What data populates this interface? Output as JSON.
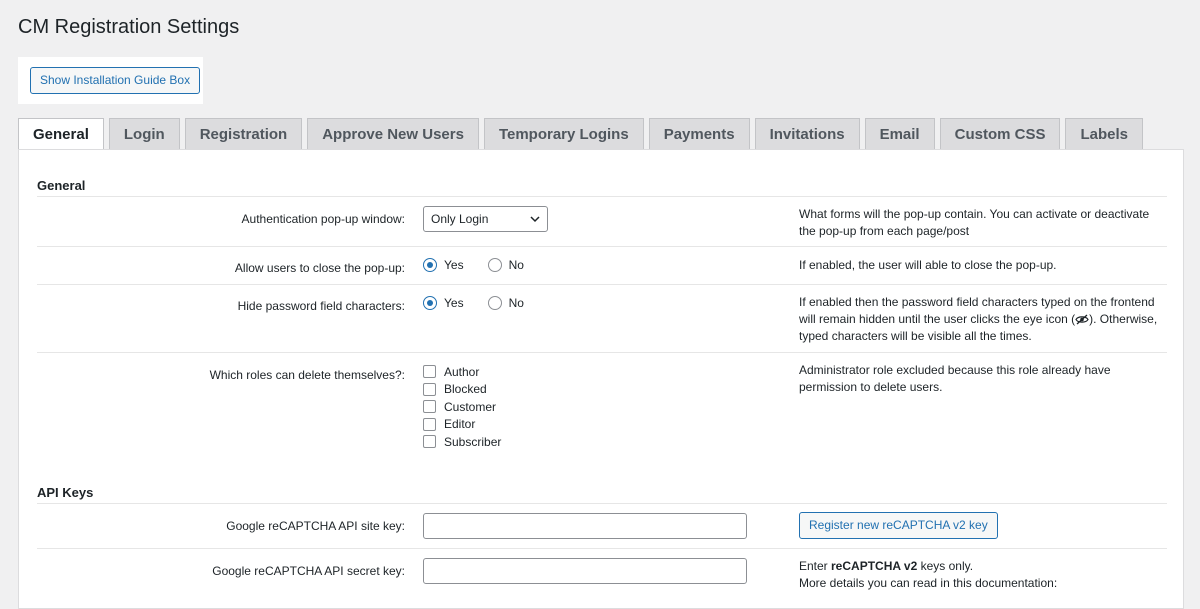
{
  "page": {
    "title": "CM Registration Settings"
  },
  "guide": {
    "button_label": "Show Installation Guide Box"
  },
  "tabs": [
    {
      "label": "General",
      "active": true
    },
    {
      "label": "Login"
    },
    {
      "label": "Registration"
    },
    {
      "label": "Approve New Users"
    },
    {
      "label": "Temporary Logins"
    },
    {
      "label": "Payments"
    },
    {
      "label": "Invitations"
    },
    {
      "label": "Email"
    },
    {
      "label": "Custom CSS"
    },
    {
      "label": "Labels"
    }
  ],
  "general": {
    "title": "General",
    "auth_popup": {
      "label": "Authentication pop-up window:",
      "value": "Only Login",
      "desc": "What forms will the pop-up contain. You can activate or deactivate the pop-up from each page/post"
    },
    "close_popup": {
      "label": "Allow users to close the pop-up:",
      "yes": "Yes",
      "no": "No",
      "selected": "Yes",
      "desc": "If enabled, the user will able to close the pop-up."
    },
    "hide_password": {
      "label": "Hide password field characters:",
      "yes": "Yes",
      "no": "No",
      "selected": "Yes",
      "desc_before": "If enabled then the password field characters typed on the frontend will remain hidden until the user clicks the eye icon (",
      "desc_after": "). Otherwise, typed characters will be visible all the times."
    },
    "delete_roles": {
      "label": "Which roles can delete themselves?:",
      "roles": [
        "Author",
        "Blocked",
        "Customer",
        "Editor",
        "Subscriber"
      ],
      "desc": "Administrator role excluded because this role already have permission to delete users."
    }
  },
  "api_keys": {
    "title": "API Keys",
    "site_key": {
      "label": "Google reCAPTCHA API site key:",
      "value": "",
      "button_label": "Register new reCAPTCHA v2 key"
    },
    "secret_key": {
      "label": "Google reCAPTCHA API secret key:",
      "value": "",
      "desc_prefix": "Enter ",
      "desc_bold": "reCAPTCHA v2",
      "desc_suffix": " keys only.",
      "desc_line2": "More details you can read in this documentation:"
    }
  },
  "colors": {
    "accent": "#2271b1",
    "background": "#f0f0f1",
    "panel": "#ffffff",
    "tab_inactive": "#dcdcde"
  },
  "icons": {
    "select_chevron": "chevron-down-icon",
    "eye": "eye-slash-icon"
  }
}
